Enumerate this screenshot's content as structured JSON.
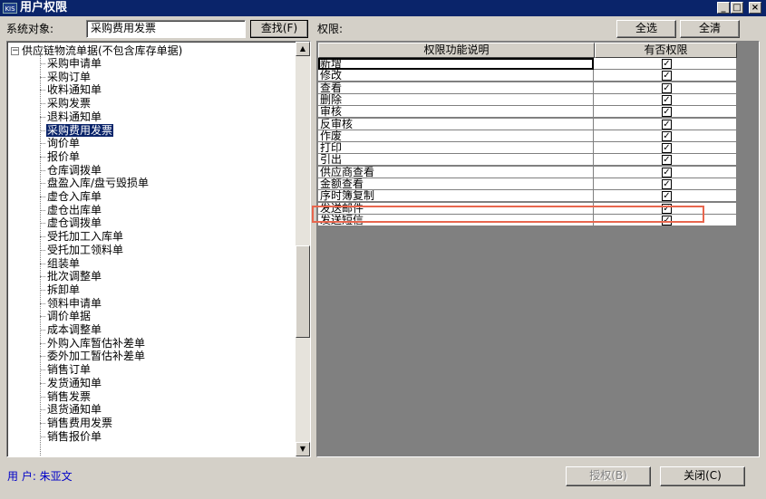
{
  "window": {
    "app_icon_text": "KIS",
    "title": "用户权限",
    "minimize": "_",
    "maximize": "□",
    "close": "×"
  },
  "toolbar": {
    "object_label": "系统对象:",
    "object_value": "采购费用发票",
    "find_button": "查找(F)",
    "rights_label": "权限:",
    "select_all_button": "全选",
    "clear_all_button": "全清"
  },
  "tree": {
    "root_label": "供应链物流单据(不包含库存单据)",
    "expander": "−",
    "items": [
      {
        "label": "采购申请单"
      },
      {
        "label": "采购订单"
      },
      {
        "label": "收料通知单"
      },
      {
        "label": "采购发票"
      },
      {
        "label": "退料通知单"
      },
      {
        "label": "采购费用发票",
        "selected": true
      },
      {
        "label": "询价单"
      },
      {
        "label": "报价单"
      },
      {
        "label": "仓库调拨单"
      },
      {
        "label": "盘盈入库/盘亏毁损单"
      },
      {
        "label": "虚仓入库单"
      },
      {
        "label": "虚仓出库单"
      },
      {
        "label": "虚仓调拨单"
      },
      {
        "label": "受托加工入库单"
      },
      {
        "label": "受托加工领料单"
      },
      {
        "label": "组装单"
      },
      {
        "label": "批次调整单"
      },
      {
        "label": "拆卸单"
      },
      {
        "label": "领料申请单"
      },
      {
        "label": "调价单据"
      },
      {
        "label": "成本调整单"
      },
      {
        "label": "外购入库暂估补差单"
      },
      {
        "label": "委外加工暂估补差单"
      },
      {
        "label": "销售订单"
      },
      {
        "label": "发货通知单"
      },
      {
        "label": "销售发票"
      },
      {
        "label": "退货通知单"
      },
      {
        "label": "销售费用发票"
      },
      {
        "label": "销售报价单"
      }
    ],
    "scroll_up": "▲",
    "scroll_down": "▼"
  },
  "grid": {
    "headers": [
      "权限功能说明",
      "有否权限"
    ],
    "rows": [
      {
        "name": "新增",
        "checked": true
      },
      {
        "name": "修改",
        "checked": true
      },
      {
        "name": "查看",
        "checked": true
      },
      {
        "name": "删除",
        "checked": true
      },
      {
        "name": "审核",
        "checked": true
      },
      {
        "name": "反审核",
        "checked": true
      },
      {
        "name": "作废",
        "checked": true
      },
      {
        "name": "打印",
        "checked": true
      },
      {
        "name": "引出",
        "checked": true
      },
      {
        "name": "供应商查看",
        "checked": true
      },
      {
        "name": "金额查看",
        "checked": true
      },
      {
        "name": "序时簿复制",
        "checked": true
      },
      {
        "name": "发送邮件",
        "checked": true
      },
      {
        "name": "发送短信",
        "checked": true
      }
    ],
    "check_mark": "✓"
  },
  "footer": {
    "user_label": "用 户: 朱亚文",
    "authorize_button": "授权(B)",
    "close_button": "关闭(C)"
  },
  "colors": {
    "title_bar": "#0a246a",
    "face": "#d4d0c8",
    "selection": "#0a246a",
    "highlight_box": "#e8664e",
    "user_text": "#0000c8"
  }
}
